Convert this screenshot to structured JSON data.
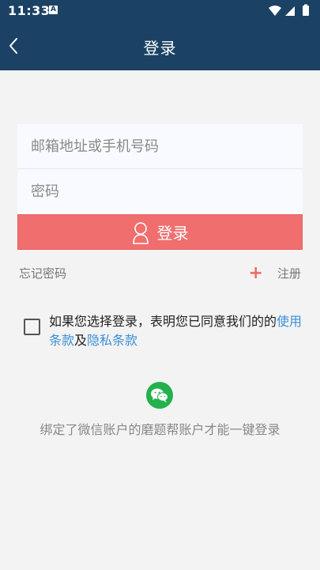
{
  "status_bar": {
    "time": "11:33",
    "notification_badge": "A"
  },
  "header": {
    "title": "登录",
    "color": "#1b4264"
  },
  "form": {
    "email_placeholder": "邮箱地址或手机号码",
    "email_value": "",
    "password_placeholder": "密码",
    "password_value": ""
  },
  "login_button": {
    "label": "登录",
    "color": "#f06e6e"
  },
  "links": {
    "forgot_password": "忘记密码",
    "register": "注册"
  },
  "agreement": {
    "prefix": "如果您选择登录，表明您已同意我们的的",
    "terms_label": "使用条款",
    "conjunction": "及",
    "privacy_label": "隐私条款",
    "link_color": "#3d8fd6"
  },
  "wechat": {
    "note": "绑定了微信账户的磨题帮账户才能一键登录",
    "color": "#22b14c"
  }
}
